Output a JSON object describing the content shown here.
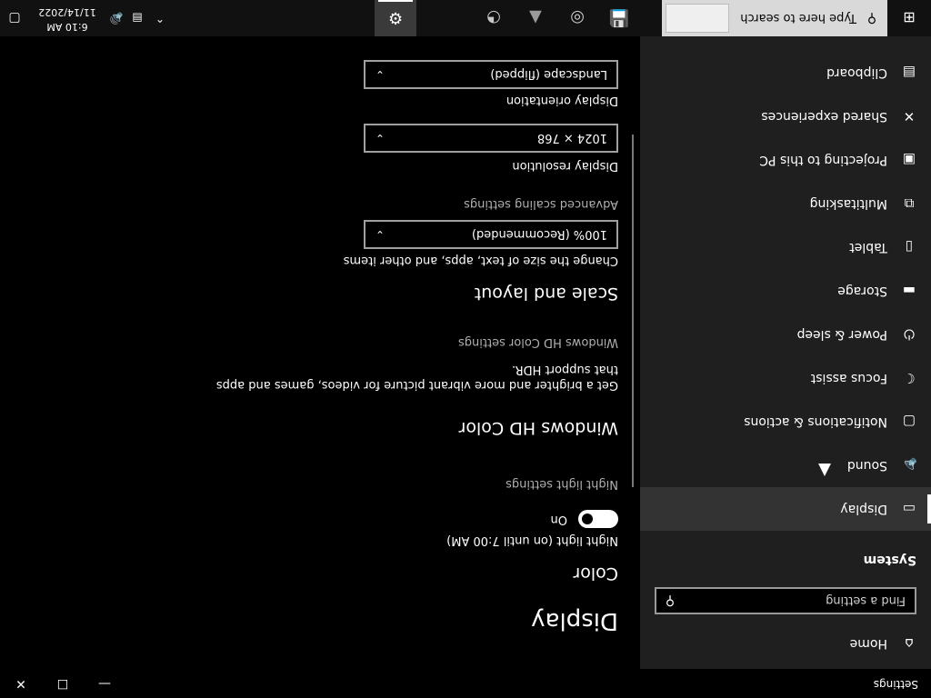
{
  "window": {
    "title": "Settings",
    "minimize_glyph": "—",
    "maximize_glyph": "☐",
    "close_glyph": "✕"
  },
  "sidebar": {
    "home_icon": "home-icon",
    "home_label": "Home",
    "search_placeholder": "Find a setting",
    "search_icon": "search-icon",
    "section_header": "System",
    "items": [
      {
        "label": "Display",
        "icon": "monitor-icon",
        "glyph": "▭"
      },
      {
        "label": "Sound",
        "icon": "speaker-icon",
        "glyph": "🔈"
      },
      {
        "label": "Notifications & actions",
        "icon": "message-icon",
        "glyph": "▢"
      },
      {
        "label": "Focus assist",
        "icon": "moon-icon",
        "glyph": "☾"
      },
      {
        "label": "Power & sleep",
        "icon": "power-icon",
        "glyph": "⏻"
      },
      {
        "label": "Storage",
        "icon": "storage-icon",
        "glyph": "▬"
      },
      {
        "label": "Tablet",
        "icon": "tablet-icon",
        "glyph": "▯"
      },
      {
        "label": "Multitasking",
        "icon": "multitasking-icon",
        "glyph": "⧉"
      },
      {
        "label": "Projecting to this PC",
        "icon": "projector-icon",
        "glyph": "▣"
      },
      {
        "label": "Shared experiences",
        "icon": "share-icon",
        "glyph": "✕"
      },
      {
        "label": "Clipboard",
        "icon": "clipboard-icon",
        "glyph": "📋"
      }
    ]
  },
  "content": {
    "page_title": "Display",
    "color_header": "Color",
    "night_light_label": "Night light (on until 7:00 AM)",
    "night_light_state": "On",
    "night_light_link": "Night light settings",
    "hd_header": "Windows HD Color",
    "hd_desc": "Get a brighter and more vibrant picture for videos, games and apps that support HDR.",
    "hd_link": "Windows HD Color settings",
    "scale_header": "Scale and layout",
    "scale_label": "Change the size of text, apps, and other items",
    "scale_value": "100% (Recommended)",
    "scale_link": "Advanced scaling settings",
    "resolution_label": "Display resolution",
    "resolution_value": "1024 × 768",
    "orientation_label": "Display orientation",
    "orientation_value": "Landscape (flipped)",
    "chevron_glyph": "⌄"
  },
  "taskbar": {
    "start_glyph": "⊞",
    "search_placeholder": "Type here to search",
    "search_icon": "search-icon",
    "apps": [
      {
        "name": "settings",
        "icon": "gear-icon",
        "glyph": "⚙",
        "color": "#ffffff"
      },
      {
        "name": "edge",
        "icon": "edge-icon",
        "glyph": "◔",
        "color": "#c8c8c8"
      },
      {
        "name": "photos",
        "icon": "photos-icon",
        "glyph": "▲",
        "color": "#9a9a9a"
      },
      {
        "name": "chrome",
        "icon": "chrome-icon",
        "glyph": "◎",
        "color": "#cfcfcf"
      },
      {
        "name": "save",
        "icon": "floppy-icon",
        "glyph": "💾",
        "color": "#e0e0e0"
      }
    ],
    "tray_chevron": "⌃",
    "network_glyph": "▤",
    "volume_glyph": "🔊",
    "time": "6:10 AM",
    "date": "11/14/2022",
    "notification_glyph": "▢"
  }
}
